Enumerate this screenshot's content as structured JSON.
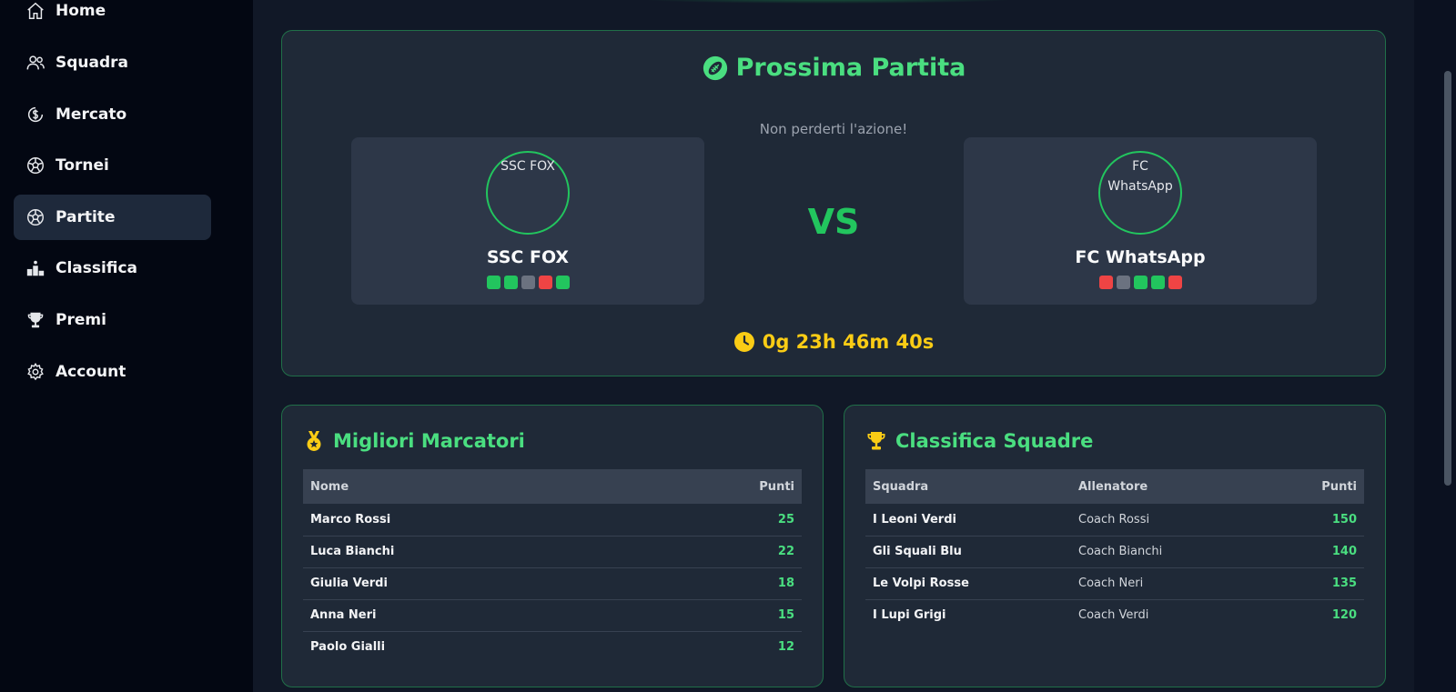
{
  "sidebar": {
    "items": [
      {
        "label": "Home",
        "icon": "home-icon"
      },
      {
        "label": "Squadra",
        "icon": "users-icon"
      },
      {
        "label": "Mercato",
        "icon": "coin-icon"
      },
      {
        "label": "Tornei",
        "icon": "soccer-ball-icon"
      },
      {
        "label": "Partite",
        "icon": "soccer-ball-icon",
        "active": true
      },
      {
        "label": "Classifica",
        "icon": "podium-icon"
      },
      {
        "label": "Premi",
        "icon": "trophy-icon"
      },
      {
        "label": "Account",
        "icon": "gear-icon"
      }
    ]
  },
  "next_match": {
    "title": "Prossima Partita",
    "subtitle": "Non perderti l'azione!",
    "vs_label": "VS",
    "countdown": "0g 23h 46m 40s",
    "home": {
      "logo_alt": "SSC FOX",
      "name": "SSC FOX",
      "form": [
        "W",
        "W",
        "D",
        "L",
        "W"
      ]
    },
    "away": {
      "logo_alt": "FC WhatsApp",
      "name": "FC WhatsApp",
      "form": [
        "L",
        "D",
        "W",
        "W",
        "L"
      ]
    }
  },
  "form_colors": {
    "W": "#22c55e",
    "D": "#6b7280",
    "L": "#ef4444"
  },
  "top_scorers": {
    "title": "Migliori Marcatori",
    "headers": {
      "name": "Nome",
      "points": "Punti"
    },
    "rows": [
      {
        "name": "Marco Rossi",
        "points": "25"
      },
      {
        "name": "Luca Bianchi",
        "points": "22"
      },
      {
        "name": "Giulia Verdi",
        "points": "18"
      },
      {
        "name": "Anna Neri",
        "points": "15"
      },
      {
        "name": "Paolo Gialli",
        "points": "12"
      }
    ]
  },
  "team_standings": {
    "title": "Classifica Squadre",
    "headers": {
      "team": "Squadra",
      "coach": "Allenatore",
      "points": "Punti"
    },
    "rows": [
      {
        "team": "I Leoni Verdi",
        "coach": "Coach Rossi",
        "points": "150"
      },
      {
        "team": "Gli Squali Blu",
        "coach": "Coach Bianchi",
        "points": "140"
      },
      {
        "team": "Le Volpi Rosse",
        "coach": "Coach Neri",
        "points": "135"
      },
      {
        "team": "I Lupi Grigi",
        "coach": "Coach Verdi",
        "points": "120"
      }
    ]
  },
  "colors": {
    "accent": "#4ade80",
    "countdown": "#facc15"
  }
}
